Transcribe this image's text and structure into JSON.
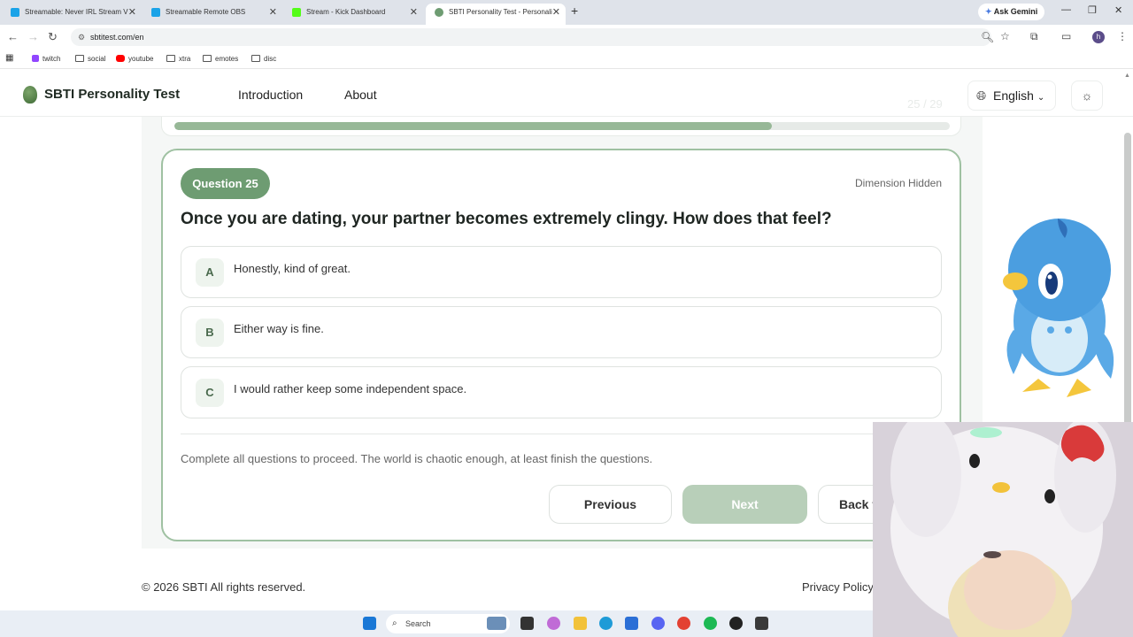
{
  "browser": {
    "tabs": [
      {
        "title": "Streamable: Never IRL Stream V",
        "favicon_color": "#1aa3e8"
      },
      {
        "title": "Streamable Remote OBS",
        "favicon_color": "#1aa3e8"
      },
      {
        "title": "Stream - Kick Dashboard",
        "favicon_color": "#53fc18"
      },
      {
        "title": "SBTI Personality Test - Personali",
        "favicon_color": "#6e9c72"
      }
    ],
    "ask_gemini": "Ask Gemini",
    "url": "sbtitest.com/en",
    "bookmarks": [
      {
        "label": "twitch",
        "icon": "twitch-icon",
        "color": "#9146ff"
      },
      {
        "label": "social",
        "icon": "folder-icon",
        "color": "#555555"
      },
      {
        "label": "youtube",
        "icon": "youtube-icon",
        "color": "#ff0000"
      },
      {
        "label": "xtra",
        "icon": "folder-icon",
        "color": "#555555"
      },
      {
        "label": "emotes",
        "icon": "folder-icon",
        "color": "#555555"
      },
      {
        "label": "disc",
        "icon": "folder-icon",
        "color": "#555555"
      }
    ],
    "profile_initial": "h"
  },
  "site": {
    "brand": "SBTI Personality Test",
    "nav": [
      "Introduction",
      "About"
    ],
    "language": "English",
    "question_count": "25 / 29"
  },
  "progress": {
    "fraction": 0.77
  },
  "quiz": {
    "badge": "Question 25",
    "dimension": "Dimension Hidden",
    "question": "Once you are dating, your partner becomes extremely clingy. How does that feel?",
    "options": [
      {
        "letter": "A",
        "text": "Honestly, kind of great."
      },
      {
        "letter": "B",
        "text": "Either way is fine."
      },
      {
        "letter": "C",
        "text": "I would rather keep some independent space."
      }
    ],
    "hint": "Complete all questions to proceed. The world is chaotic enough, at least finish the questions.",
    "buttons": {
      "previous": "Previous",
      "next": "Next",
      "back": "Back t"
    }
  },
  "footer": {
    "copyright": "© 2026 SBTI All rights reserved.",
    "privacy": "Privacy Policy"
  },
  "taskbar": {
    "search": "Search"
  },
  "colors": {
    "accent": "#6e9c72",
    "card_border": "#9fc1a2",
    "next_disabled": "#b8cfb9"
  }
}
